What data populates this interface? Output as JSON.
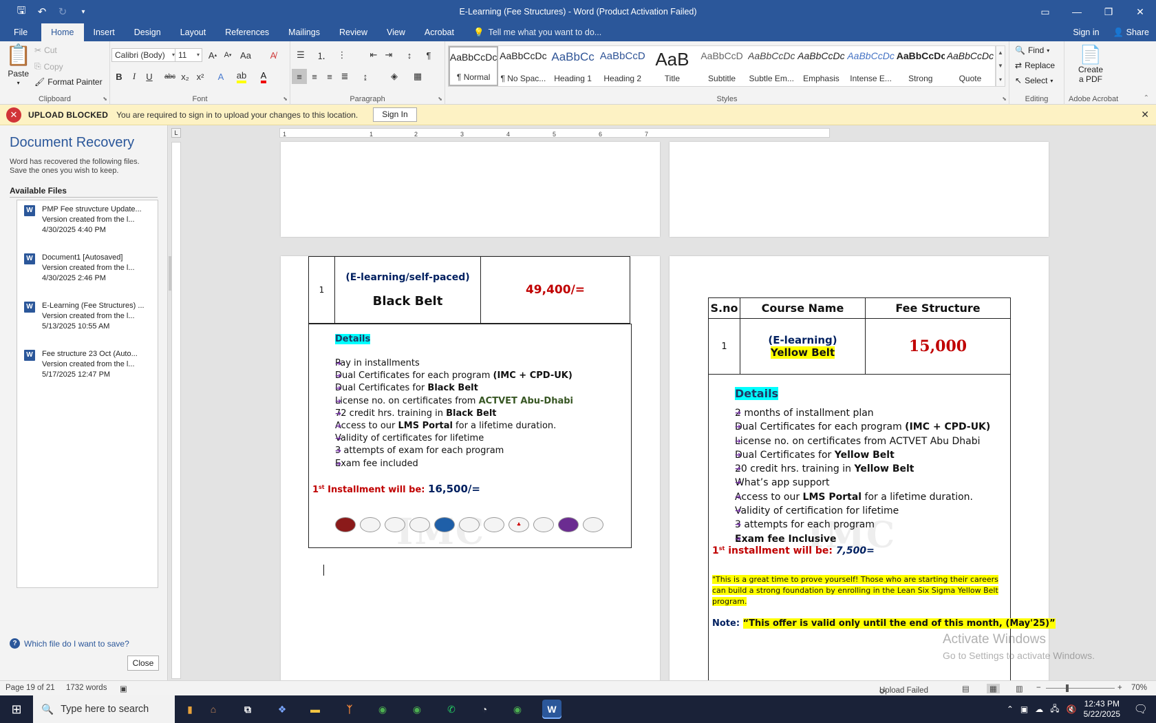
{
  "window": {
    "title": "E-Learning (Fee Structures) - Word (Product Activation Failed)"
  },
  "qat": {
    "save": "save-icon",
    "undo": "undo-icon",
    "redo": "redo-icon"
  },
  "tabs": [
    "File",
    "Home",
    "Insert",
    "Design",
    "Layout",
    "References",
    "Mailings",
    "Review",
    "View",
    "Acrobat"
  ],
  "tell_me": "Tell me what you want to do...",
  "header_right": {
    "signin": "Sign in",
    "share": "Share"
  },
  "ribbon": {
    "clipboard": {
      "paste": "Paste",
      "cut": "Cut",
      "copy": "Copy",
      "format_painter": "Format Painter",
      "label": "Clipboard"
    },
    "font": {
      "family": "Calibri (Body)",
      "size": "11",
      "label": "Font",
      "bold": "B",
      "italic": "I",
      "underline": "U",
      "strike": "abc",
      "sub": "x₂",
      "sup": "x²"
    },
    "paragraph": {
      "label": "Paragraph"
    },
    "styles": {
      "label": "Styles",
      "items": [
        {
          "preview": "AaBbCcDc",
          "name": "¶ Normal"
        },
        {
          "preview": "AaBbCcDc",
          "name": "¶ No Spac..."
        },
        {
          "preview": "AaBbCc",
          "name": "Heading 1"
        },
        {
          "preview": "AaBbCcD",
          "name": "Heading 2"
        },
        {
          "preview": "AaB",
          "name": "Title"
        },
        {
          "preview": "AaBbCcD",
          "name": "Subtitle"
        },
        {
          "preview": "AaBbCcDc",
          "name": "Subtle Em..."
        },
        {
          "preview": "AaBbCcDc",
          "name": "Emphasis"
        },
        {
          "preview": "AaBbCcDc",
          "name": "Intense E..."
        },
        {
          "preview": "AaBbCcDc",
          "name": "Strong"
        },
        {
          "preview": "AaBbCcDc",
          "name": "Quote"
        }
      ]
    },
    "editing": {
      "find": "Find",
      "replace": "Replace",
      "select": "Select",
      "label": "Editing"
    },
    "acrobat": {
      "create1": "Create",
      "create2": "a PDF",
      "label": "Adobe Acrobat"
    }
  },
  "message_bar": {
    "title": "UPLOAD BLOCKED",
    "text": "You are required to sign in to upload your changes to this location.",
    "button": "Sign In"
  },
  "recovery": {
    "title": "Document Recovery",
    "desc1": "Word has recovered the following files.",
    "desc2": "Save the ones you wish to keep.",
    "available": "Available Files",
    "files": [
      {
        "name": "PMP Fee struvcture Update...",
        "version": "Version created from the l...",
        "date": "4/30/2025 4:40 PM"
      },
      {
        "name": "Document1  [Autosaved]",
        "version": "Version created from the l...",
        "date": "4/30/2025 2:46 PM"
      },
      {
        "name": "E-Learning (Fee Structures) ...",
        "version": "Version created from the l...",
        "date": "5/13/2025 10:55 AM"
      },
      {
        "name": "Fee structure 23 Oct (Auto...",
        "version": "Version created from the l...",
        "date": "5/17/2025 12:47 PM"
      }
    ],
    "help": "Which file do I want to save?",
    "close": "Close"
  },
  "ruler": {
    "marks": [
      "1",
      "1",
      "2",
      "3",
      "4",
      "5",
      "6",
      "7"
    ]
  },
  "left_page": {
    "sno": "1",
    "course_sub": "(E-learning/self-paced)",
    "course_name": "Black Belt",
    "fee": "49,400/=",
    "details": "Details",
    "bullets": [
      {
        "pre": "Pay in installments",
        "bold": "",
        "post": ""
      },
      {
        "pre": "Dual Certificates for each program ",
        "bold": "(IMC + CPD-UK)",
        "post": ""
      },
      {
        "pre": "Dual Certificates for ",
        "bold": "Black Belt",
        "post": ""
      },
      {
        "pre": "License no. on certificates from ",
        "bold": "ACTVET Abu-Dhabi",
        "post": ""
      },
      {
        "pre": "72 credit hrs. training in ",
        "bold": "Black Belt",
        "post": ""
      },
      {
        "pre": "Access to our ",
        "bold": "LMS Portal",
        "post": " for a lifetime duration."
      },
      {
        "pre": "Validity of certificates for lifetime",
        "bold": "",
        "post": ""
      },
      {
        "pre": "3 attempts of exam for each program",
        "bold": "",
        "post": ""
      },
      {
        "pre": "Exam fee included",
        "bold": "",
        "post": ""
      }
    ],
    "inst_pre": "1",
    "inst_sup": "st",
    "inst_label": " Installment will be: ",
    "inst_value": "16,500/="
  },
  "right_page": {
    "headers": [
      "S.no",
      "Course Name",
      "Fee Structure"
    ],
    "sno": "1",
    "course_sub": "(E-learning)",
    "course_name": "Yellow Belt",
    "fee": "15,000",
    "details": "Details",
    "bullets": [
      {
        "pre": "2 months of installment plan",
        "bold": "",
        "post": ""
      },
      {
        "pre": "Dual Certificates for each program ",
        "bold": "(IMC + CPD-UK)",
        "post": ""
      },
      {
        "pre": "License no. on certificates from ACTVET Abu Dhabi",
        "bold": "",
        "post": ""
      },
      {
        "pre": "Dual Certificates for ",
        "bold": "Yellow Belt",
        "post": ""
      },
      {
        "pre": "20 credit hrs. training in ",
        "bold": "Yellow Belt",
        "post": ""
      },
      {
        "pre": "What’s app support",
        "bold": "",
        "post": ""
      },
      {
        "pre": "Access to our ",
        "bold": "LMS Portal",
        "post": " for a lifetime duration."
      },
      {
        "pre": "Validity of certification for lifetime",
        "bold": "",
        "post": ""
      },
      {
        "pre": "3 attempts for each program",
        "bold": "",
        "post": ""
      },
      {
        "pre": "",
        "bold": "Exam fee Inclusive",
        "post": ""
      }
    ],
    "inst_pre": "1",
    "inst_sup": "st",
    "inst_label": " installment will be: ",
    "inst_value": "7,500=",
    "quote": "\"This is a great time to prove yourself! Those who are starting their careers can build a strong foundation by enrolling in the Lean Six Sigma Yellow Belt program.",
    "note_label": "Note: ",
    "note_text": "“This offer is valid only until the end of this month, (May'25)”"
  },
  "watermark": "IMC",
  "activate": {
    "line1": "Activate Windows",
    "line2": "Go to Settings to activate Windows."
  },
  "status": {
    "page": "Page 19 of 21",
    "words": "1732 words",
    "upload": "Upload Failed",
    "zoom": "70%"
  },
  "taskbar": {
    "search": "Type here to search",
    "time": "12:43 PM",
    "date": "5/22/2025"
  }
}
